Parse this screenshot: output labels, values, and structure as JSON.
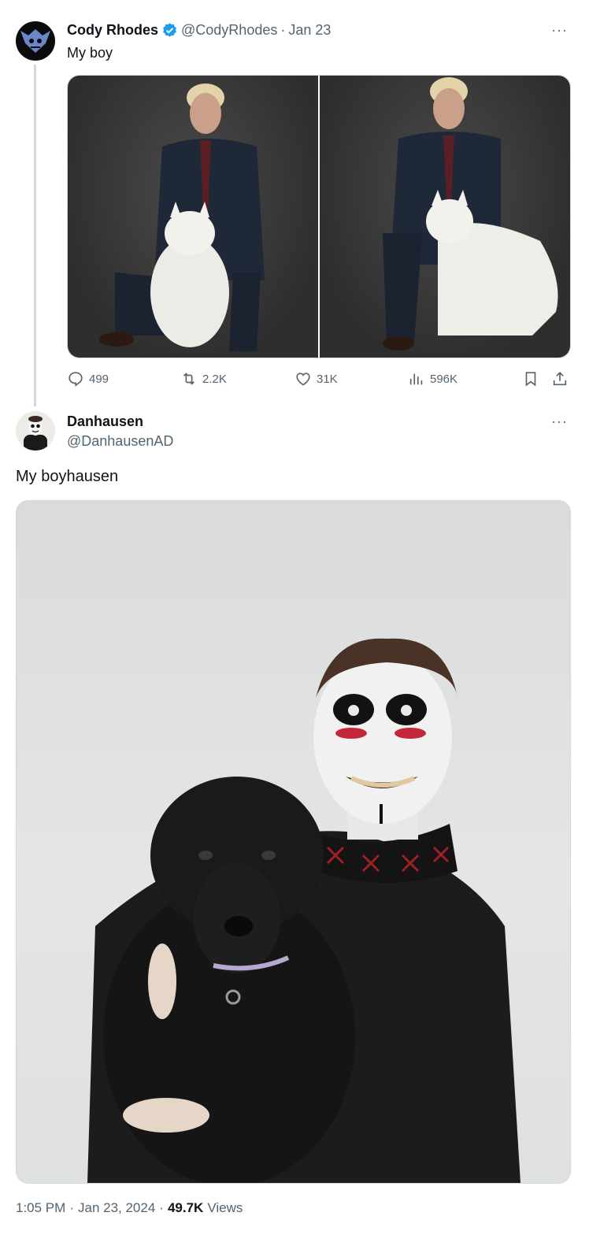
{
  "tweet1": {
    "display_name": "Cody Rhodes",
    "handle": "@CodyRhodes",
    "separator": "·",
    "date": "Jan 23",
    "text": "My boy",
    "verified_icon": "verified-badge-icon",
    "more_label": "···",
    "actions": {
      "replies": "499",
      "retweets": "2.2K",
      "likes": "31K",
      "views": "596K"
    }
  },
  "tweet2": {
    "display_name": "Danhausen",
    "handle": "@DanhausenAD",
    "text": "My boyhausen",
    "more_label": "···"
  },
  "footer": {
    "time": "1:05 PM",
    "sep1": "·",
    "date": "Jan 23, 2024",
    "sep2": "·",
    "views_count": "49.7K",
    "views_label": "Views"
  },
  "colors": {
    "verified": "#1d9bf0",
    "text_primary": "#0f1419",
    "text_secondary": "#536471",
    "thread_line": "#cfd9de"
  }
}
